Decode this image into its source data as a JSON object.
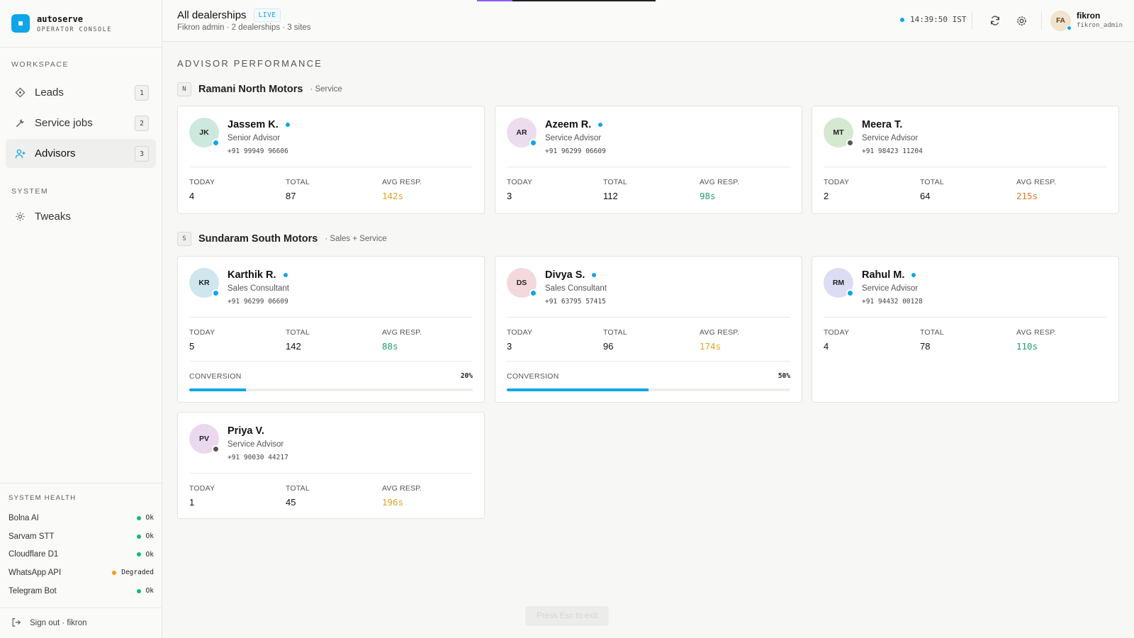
{
  "brand": {
    "name": "autoserve",
    "subtitle": "OPERATOR CONSOLE"
  },
  "sidebar": {
    "workspace_label": "WORKSPACE",
    "items": [
      {
        "label": "Leads",
        "count": "1",
        "icon": "diamond-icon"
      },
      {
        "label": "Service jobs",
        "count": "2",
        "icon": "wrench-icon"
      },
      {
        "label": "Advisors",
        "count": "3",
        "icon": "user-plus-icon",
        "active": true
      }
    ],
    "system_label": "SYSTEM",
    "system_items": [
      {
        "label": "Tweaks",
        "icon": "gear-icon"
      }
    ],
    "health": {
      "title": "SYSTEM HEALTH",
      "services": [
        {
          "name": "Bolna AI",
          "status": "Ok",
          "color": "#10b981"
        },
        {
          "name": "Sarvam STT",
          "status": "Ok",
          "color": "#10b981"
        },
        {
          "name": "Cloudflare D1",
          "status": "Ok",
          "color": "#10b981"
        },
        {
          "name": "WhatsApp API",
          "status": "Degraded",
          "color": "#f59e0b"
        },
        {
          "name": "Telegram Bot",
          "status": "Ok",
          "color": "#10b981"
        }
      ]
    },
    "sign_out": "Sign out · fikron"
  },
  "header": {
    "title": "All dealerships",
    "live_badge": "LIVE",
    "subtitle": "Fikron admin · 2 dealerships · 3 sites",
    "clock": "14:39:50 IST",
    "user": {
      "initials": "FA",
      "name": "fikron",
      "handle": "fikron_admin"
    }
  },
  "main": {
    "heading": "ADVISOR PERFORMANCE",
    "stat_labels": {
      "today": "TODAY",
      "total": "TOTAL",
      "avg": "AVG RESP.",
      "conversion": "CONVERSION"
    },
    "groups": [
      {
        "mark": "N",
        "name": "Ramani North Motors",
        "kind": "· Service",
        "advisors": [
          {
            "initials": "JK",
            "name": "Jassem K.",
            "role": "Senior Advisor",
            "phone": "+91 99949 96606",
            "today": "4",
            "total": "87",
            "avg": "142s",
            "avg_color": "#e0a526",
            "online": true,
            "avatar_bg": "#cde8dc"
          },
          {
            "initials": "AR",
            "name": "Azeem R.",
            "role": "Service Advisor",
            "phone": "+91 96299 06609",
            "today": "3",
            "total": "112",
            "avg": "98s",
            "avg_color": "#22a06b",
            "online": true,
            "avatar_bg": "#ecdcee"
          },
          {
            "initials": "MT",
            "name": "Meera T.",
            "role": "Service Advisor",
            "phone": "+91 98423 11204",
            "today": "2",
            "total": "64",
            "avg": "215s",
            "avg_color": "#e07a2a",
            "online": false,
            "avatar_bg": "#d5e8d0"
          }
        ]
      },
      {
        "mark": "S",
        "name": "Sundaram South Motors",
        "kind": "· Sales + Service",
        "advisors": [
          {
            "initials": "KR",
            "name": "Karthik R.",
            "role": "Sales Consultant",
            "phone": "+91 96299 06609",
            "today": "5",
            "total": "142",
            "avg": "88s",
            "avg_color": "#22a06b",
            "online": true,
            "avatar_bg": "#cfe6ef",
            "conversion": "20%",
            "conversion_value": 0.2
          },
          {
            "initials": "DS",
            "name": "Divya S.",
            "role": "Sales Consultant",
            "phone": "+91 63795 57415",
            "today": "3",
            "total": "96",
            "avg": "174s",
            "avg_color": "#e0a526",
            "online": true,
            "avatar_bg": "#f3d9dc",
            "conversion": "50%",
            "conversion_value": 0.5
          },
          {
            "initials": "RM",
            "name": "Rahul M.",
            "role": "Service Advisor",
            "phone": "+91 94432 00128",
            "today": "4",
            "total": "78",
            "avg": "110s",
            "avg_color": "#22a06b",
            "online": true,
            "avatar_bg": "#dcdcf3"
          },
          {
            "initials": "PV",
            "name": "Priya V.",
            "role": "Service Advisor",
            "phone": "+91 90030 44217",
            "today": "1",
            "total": "45",
            "avg": "196s",
            "avg_color": "#e0a526",
            "online": false,
            "avatar_bg": "#ead8ee"
          }
        ]
      }
    ]
  },
  "esc_hint": "Press Esc to exit"
}
